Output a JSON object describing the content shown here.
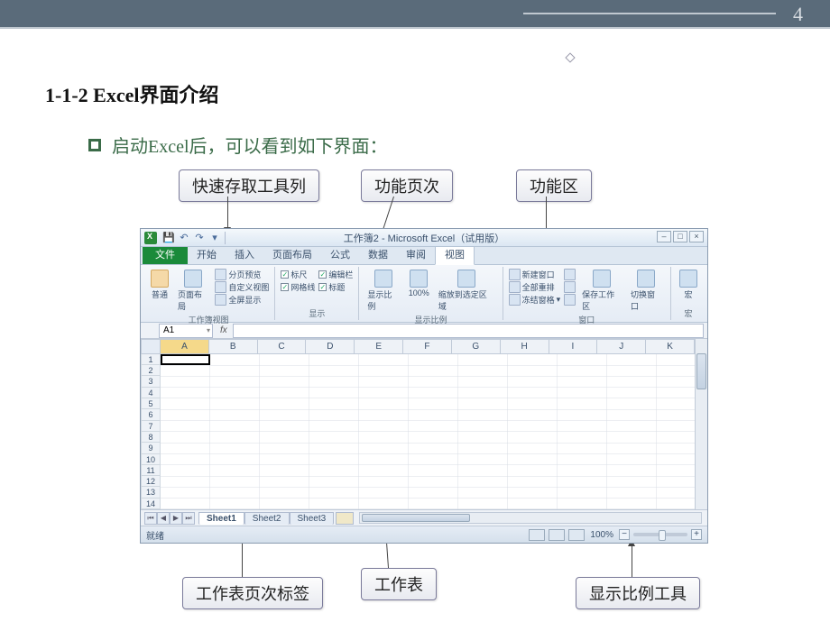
{
  "page_number": "4",
  "slide_title": "1-1-2 Excel界面介绍",
  "bullet_text": "启动Excel后，可以看到如下界面：",
  "callouts": {
    "qat": "快速存取工具列",
    "ribbon_tabs": "功能页次",
    "ribbon": "功能区",
    "sheet_tabs": "工作表页次标签",
    "worksheet": "工作表",
    "zoom": "显示比例工具"
  },
  "excel": {
    "window_title": "工作簿2 - Microsoft Excel（试用版）",
    "file_tab": "文件",
    "tabs": [
      "开始",
      "插入",
      "页面布局",
      "公式",
      "数据",
      "审阅",
      "视图"
    ],
    "active_tab": "视图",
    "ribbon_groups": {
      "workbook_views": {
        "label": "工作簿视图",
        "normal": "普通",
        "page_layout": "页面布局",
        "items": [
          "分页预览",
          "自定义视图",
          "全屏显示"
        ]
      },
      "show": {
        "label": "显示",
        "ruler": "标尺",
        "gridlines": "网格线",
        "formula_bar": "编辑栏",
        "headings": "标题"
      },
      "zoom": {
        "label": "显示比例",
        "zoom": "显示比例",
        "hundred": "100%",
        "to_selection": "缩放到选定区域"
      },
      "window": {
        "label": "窗口",
        "new_window": "新建窗口",
        "arrange_all": "全部重排",
        "freeze": "冻结窗格",
        "save_ws": "保存工作区",
        "switch": "切换窗口"
      },
      "macros": {
        "label": "宏",
        "macros": "宏"
      }
    },
    "name_box": "A1",
    "columns": [
      "A",
      "B",
      "C",
      "D",
      "E",
      "F",
      "G",
      "H",
      "I",
      "J",
      "K"
    ],
    "rows": [
      "1",
      "2",
      "3",
      "4",
      "5",
      "6",
      "7",
      "8",
      "9",
      "10",
      "11",
      "12",
      "13",
      "14"
    ],
    "sheets": [
      "Sheet1",
      "Sheet2",
      "Sheet3"
    ],
    "active_sheet": "Sheet1",
    "status_ready": "就绪",
    "zoom_pct": "100%"
  }
}
